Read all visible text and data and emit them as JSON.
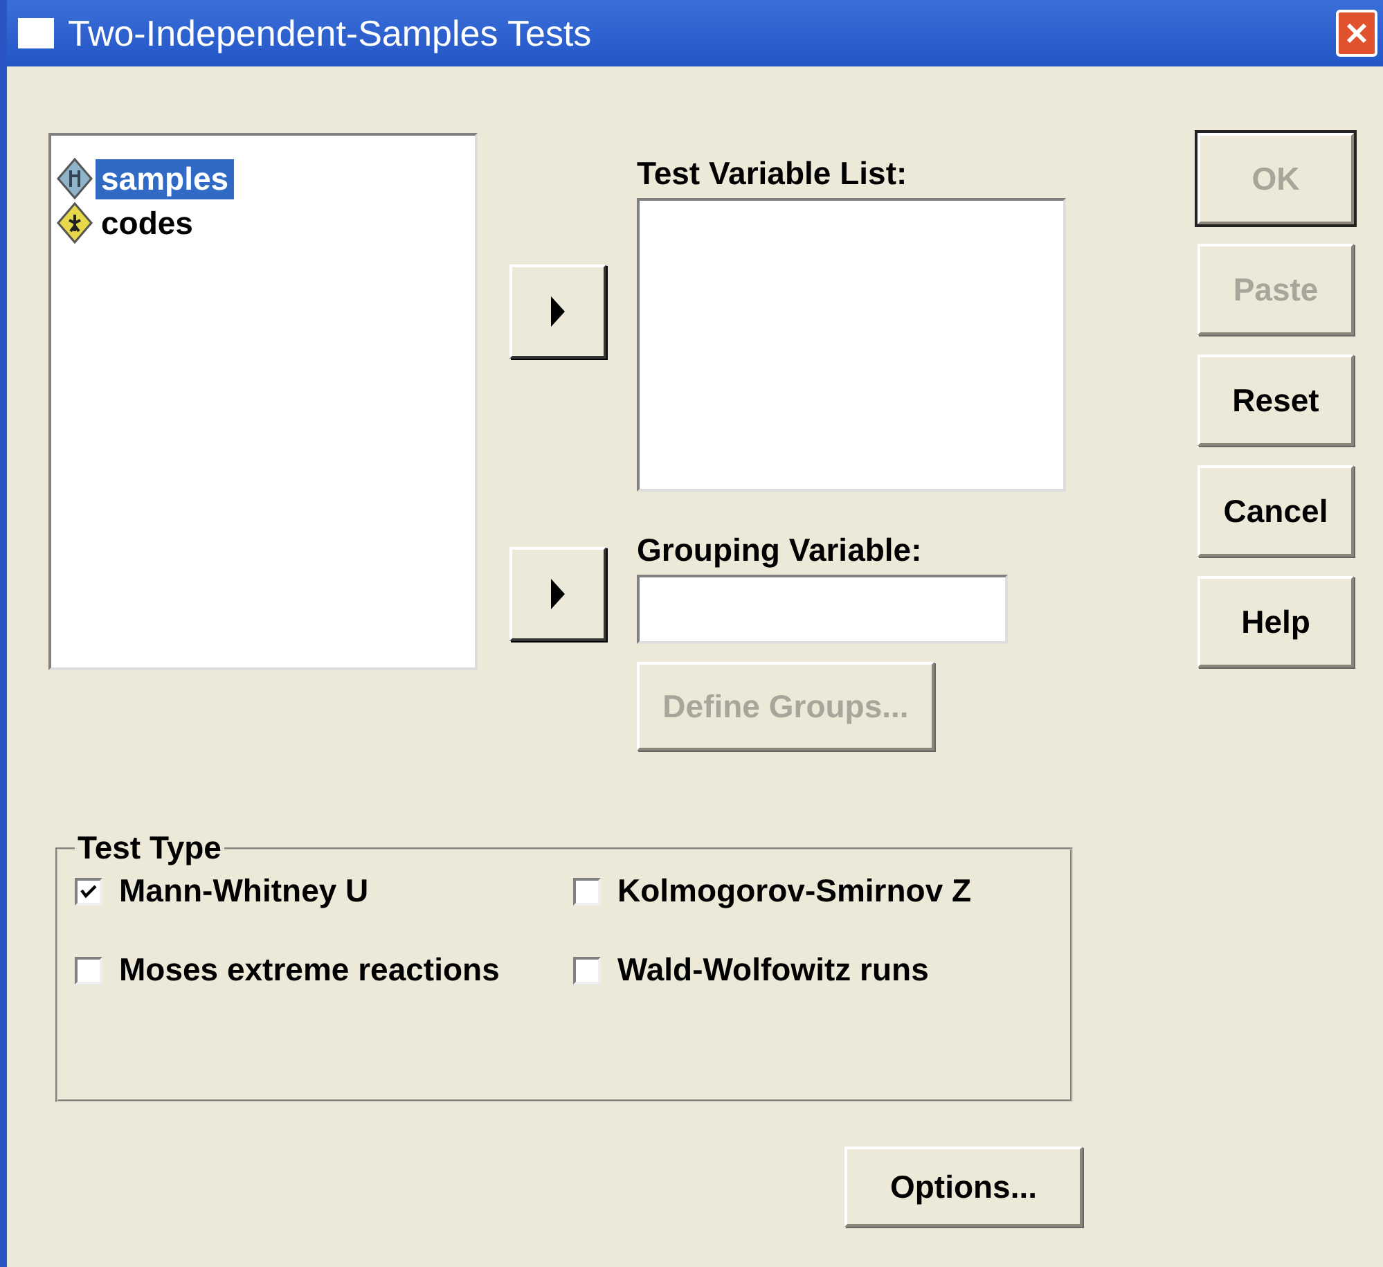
{
  "window": {
    "title": "Two-Independent-Samples Tests"
  },
  "source_variables": [
    {
      "label": "samples",
      "selected": true,
      "kind": "scale"
    },
    {
      "label": "codes",
      "selected": false,
      "kind": "nominal"
    }
  ],
  "test_variable_list": {
    "label": "Test Variable List:"
  },
  "grouping_variable": {
    "label": "Grouping Variable:"
  },
  "define_groups": {
    "label": "Define Groups...",
    "disabled": true
  },
  "buttons": [
    {
      "label": "OK",
      "disabled": true,
      "default": true
    },
    {
      "label": "Paste",
      "disabled": true,
      "default": false
    },
    {
      "label": "Reset",
      "disabled": false,
      "default": false
    },
    {
      "label": "Cancel",
      "disabled": false,
      "default": false
    },
    {
      "label": "Help",
      "disabled": false,
      "default": false
    }
  ],
  "test_type": {
    "title": "Test Type",
    "options": [
      {
        "label": "Mann-Whitney U",
        "checked": true
      },
      {
        "label": "Kolmogorov-Smirnov Z",
        "checked": false
      },
      {
        "label": "Moses extreme reactions",
        "checked": false
      },
      {
        "label": "Wald-Wolfowitz runs",
        "checked": false
      }
    ]
  },
  "options_button": {
    "label": "Options..."
  }
}
